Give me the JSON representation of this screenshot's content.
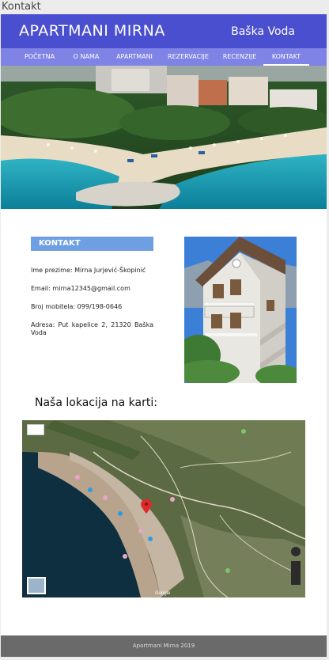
{
  "window": {
    "title": "Kontakt"
  },
  "header": {
    "site_title": "APARTMANI MIRNA",
    "location": "Baška Voda"
  },
  "nav": {
    "items": [
      {
        "label": "POČETNA"
      },
      {
        "label": "O NAMA"
      },
      {
        "label": "APARTMANI"
      },
      {
        "label": "REZERVACIJE"
      },
      {
        "label": "RECENZIJE"
      },
      {
        "label": "KONTAKT"
      }
    ],
    "active": "KONTAKT"
  },
  "contact": {
    "heading": "KONTAKT",
    "name": "Ime prezime: Mirna Jurjević-Škopinić",
    "email": "Email: mirna12345@gmail.com",
    "phone": "Broj mobitela: 099/198-0646",
    "address": "Adresa: Put kapelice 2, 21320 Baška Voda"
  },
  "map_section": {
    "heading": "Naša lokacija na karti:",
    "provider": "Google"
  },
  "footer": {
    "text": "Apartmani Mirna 2019"
  },
  "colors": {
    "header": "#4a4fcf",
    "nav": "#7f83e6",
    "contact_heading": "#6f9fe3",
    "footer": "#6a6a6a"
  }
}
